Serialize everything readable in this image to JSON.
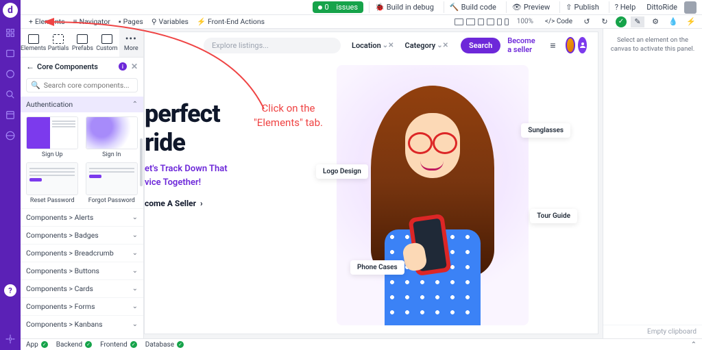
{
  "topbar": {
    "issues_count": "0",
    "issues_label": "issues",
    "build_debug": "Build in debug",
    "build_code": "Build code",
    "preview": "Preview",
    "publish": "Publish",
    "help": "? Help",
    "app_name": "DittoRide"
  },
  "toolbar2": {
    "elements": "Elements",
    "navigator": "Navigator",
    "pages": "Pages",
    "variables": "Variables",
    "frontend_actions": "Front-End Actions",
    "zoom": "100%",
    "code": "</> Code"
  },
  "panel": {
    "shelf": {
      "elements": "Elements",
      "partials": "Partials",
      "prefabs": "Prefabs",
      "custom": "Custom",
      "more": "More"
    },
    "title": "Core Components",
    "search_placeholder": "Search core components...",
    "auth": "Authentication",
    "thumbs": {
      "signup": "Sign Up",
      "signin": "Sign In",
      "reset": "Reset Password",
      "forgot": "Forgot Password"
    },
    "sections": [
      "Components > Alerts",
      "Components > Badges",
      "Components > Breadcrumb",
      "Components > Buttons",
      "Components > Cards",
      "Components > Forms",
      "Components > Kanbans"
    ]
  },
  "page": {
    "search_placeholder": "Explore listings...",
    "filter_location": "Location",
    "filter_category": "Category",
    "search_btn": "Search",
    "become_seller": "Become a seller",
    "hero_title": "perfect ride",
    "hero_sub_1": "et's Track Down That",
    "hero_sub_2": "vice Together!",
    "seller_link": "come A Seller",
    "labels": {
      "sunglasses": "Sunglasses",
      "logo": "Logo Design",
      "tour": "Tour Guide",
      "phone": "Phone Cases"
    }
  },
  "props": {
    "empty_msg": "Select an element on the canvas to activate this panel.",
    "clipboard": "Empty clipboard"
  },
  "status": {
    "app": "App",
    "backend": "Backend",
    "frontend": "Frontend",
    "database": "Database"
  },
  "annotation": {
    "line1": "Click on the",
    "line2": "\"Elements\" tab."
  }
}
